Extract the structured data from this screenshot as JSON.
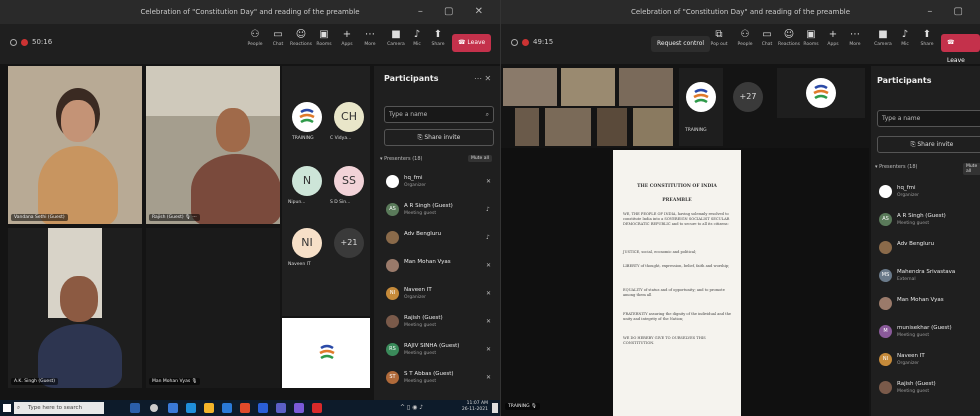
{
  "left_window": {
    "title": "Celebration of \"Constitution Day\" and reading of the preamble",
    "timer": "50:16",
    "toolbar": [
      {
        "label": "People",
        "icon": "people-icon"
      },
      {
        "label": "Chat",
        "icon": "chat-icon"
      },
      {
        "label": "Reactions",
        "icon": "reactions-icon"
      },
      {
        "label": "Rooms",
        "icon": "rooms-icon"
      },
      {
        "label": "Apps",
        "icon": "apps-icon"
      },
      {
        "label": "More",
        "icon": "more-icon"
      },
      {
        "label": "Camera",
        "icon": "camera-icon"
      },
      {
        "label": "Mic",
        "icon": "mic-icon"
      },
      {
        "label": "Share",
        "icon": "share-icon"
      }
    ],
    "leave_label": "Leave",
    "video_tiles": [
      {
        "name": "Vandana Sethi (Guest)"
      },
      {
        "name": "Rajish (Guest)"
      },
      {
        "name": "A.K. Singh (Guest)"
      },
      {
        "name": "Man Mohan Vyas"
      }
    ],
    "avatar_grid": [
      {
        "initials": "",
        "name": "TRAINING"
      },
      {
        "initials": "CH",
        "name": "C Vidya..."
      },
      {
        "initials": "N",
        "name": "Nipun..."
      },
      {
        "initials": "SS",
        "name": "S D Sin..."
      },
      {
        "initials": "NI",
        "name": "Naveen IT"
      },
      {
        "initials": "+21",
        "name": ""
      }
    ],
    "participants": {
      "title": "Participants",
      "search_placeholder": "Type a name",
      "share_invite": "Share invite",
      "section": "Presenters (18)",
      "mute_all": "Mute all",
      "list": [
        {
          "name": "hq_fmi",
          "role": "Organizer",
          "initials": ""
        },
        {
          "name": "A R Singh (Guest)",
          "role": "Meeting guest",
          "initials": "AS"
        },
        {
          "name": "Adv Bengluru",
          "role": "",
          "initials": ""
        },
        {
          "name": "Man Mohan Vyas",
          "role": "",
          "initials": ""
        },
        {
          "name": "Naveen IT",
          "role": "Organizer",
          "initials": "NI"
        },
        {
          "name": "Rajish (Guest)",
          "role": "Meeting guest",
          "initials": ""
        },
        {
          "name": "RAJIV SINHA (Guest)",
          "role": "Meeting guest",
          "initials": "RS"
        },
        {
          "name": "S T Abbas (Guest)",
          "role": "Meeting guest",
          "initials": "ST"
        }
      ]
    },
    "taskbar": {
      "search_placeholder": "Type here to search",
      "time": "11:07 AM",
      "date": "26-11-2021"
    }
  },
  "right_window": {
    "title": "Celebration of \"Constitution Day\" and reading of the preamble",
    "timer": "49:15",
    "request_control": "Request control",
    "toolbar": [
      {
        "label": "Pop out",
        "icon": "popout-icon"
      },
      {
        "label": "People",
        "icon": "people-icon"
      },
      {
        "label": "Chat",
        "icon": "chat-icon"
      },
      {
        "label": "Reactions",
        "icon": "reactions-icon"
      },
      {
        "label": "Rooms",
        "icon": "rooms-icon"
      },
      {
        "label": "Apps",
        "icon": "apps-icon"
      },
      {
        "label": "More",
        "icon": "more-icon"
      },
      {
        "label": "Camera",
        "icon": "camera-icon"
      },
      {
        "label": "Mic",
        "icon": "mic-icon"
      },
      {
        "label": "Share",
        "icon": "share-icon"
      }
    ],
    "leave_label": "Leave",
    "strip_count": "+27",
    "strip_tag": "TRAINING",
    "presenter_tag": "TRAINING",
    "document": {
      "heading": "THE CONSTITUTION OF INDIA",
      "subheading": "PREAMBLE",
      "paragraphs": [
        "WE, THE PEOPLE OF INDIA, having solemnly resolved to constitute India into a SOVEREIGN SOCIALIST SECULAR DEMOCRATIC REPUBLIC and to secure to all its citizens:",
        "JUSTICE, social, economic and political;",
        "LIBERTY of thought, expression, belief, faith and worship;",
        "EQUALITY of status and of opportunity; and to promote among them all",
        "FRATERNITY assuring the dignity of the individual and the unity and integrity of the Nation;",
        "WE DO HEREBY GIVE TO OURSELVES THIS CONSTITUTION."
      ]
    },
    "participants": {
      "title": "Participants",
      "search_placeholder": "Type a name",
      "share_invite": "Share invite",
      "section": "Presenters (18)",
      "mute_all": "Mute all",
      "list": [
        {
          "name": "hq_fmi",
          "role": "Organizer",
          "initials": ""
        },
        {
          "name": "A R Singh (Guest)",
          "role": "Meeting guest",
          "initials": "AS"
        },
        {
          "name": "Adv Bengluru",
          "role": "",
          "initials": ""
        },
        {
          "name": "Mahendra Srivastava",
          "role": "External",
          "initials": "MS"
        },
        {
          "name": "Man Mohan Vyas",
          "role": "",
          "initials": ""
        },
        {
          "name": "munisekhar (Guest)",
          "role": "Meeting guest",
          "initials": "M"
        },
        {
          "name": "Naveen IT",
          "role": "Organizer",
          "initials": "NI"
        },
        {
          "name": "Rajish (Guest)",
          "role": "Meeting guest",
          "initials": ""
        }
      ]
    }
  }
}
